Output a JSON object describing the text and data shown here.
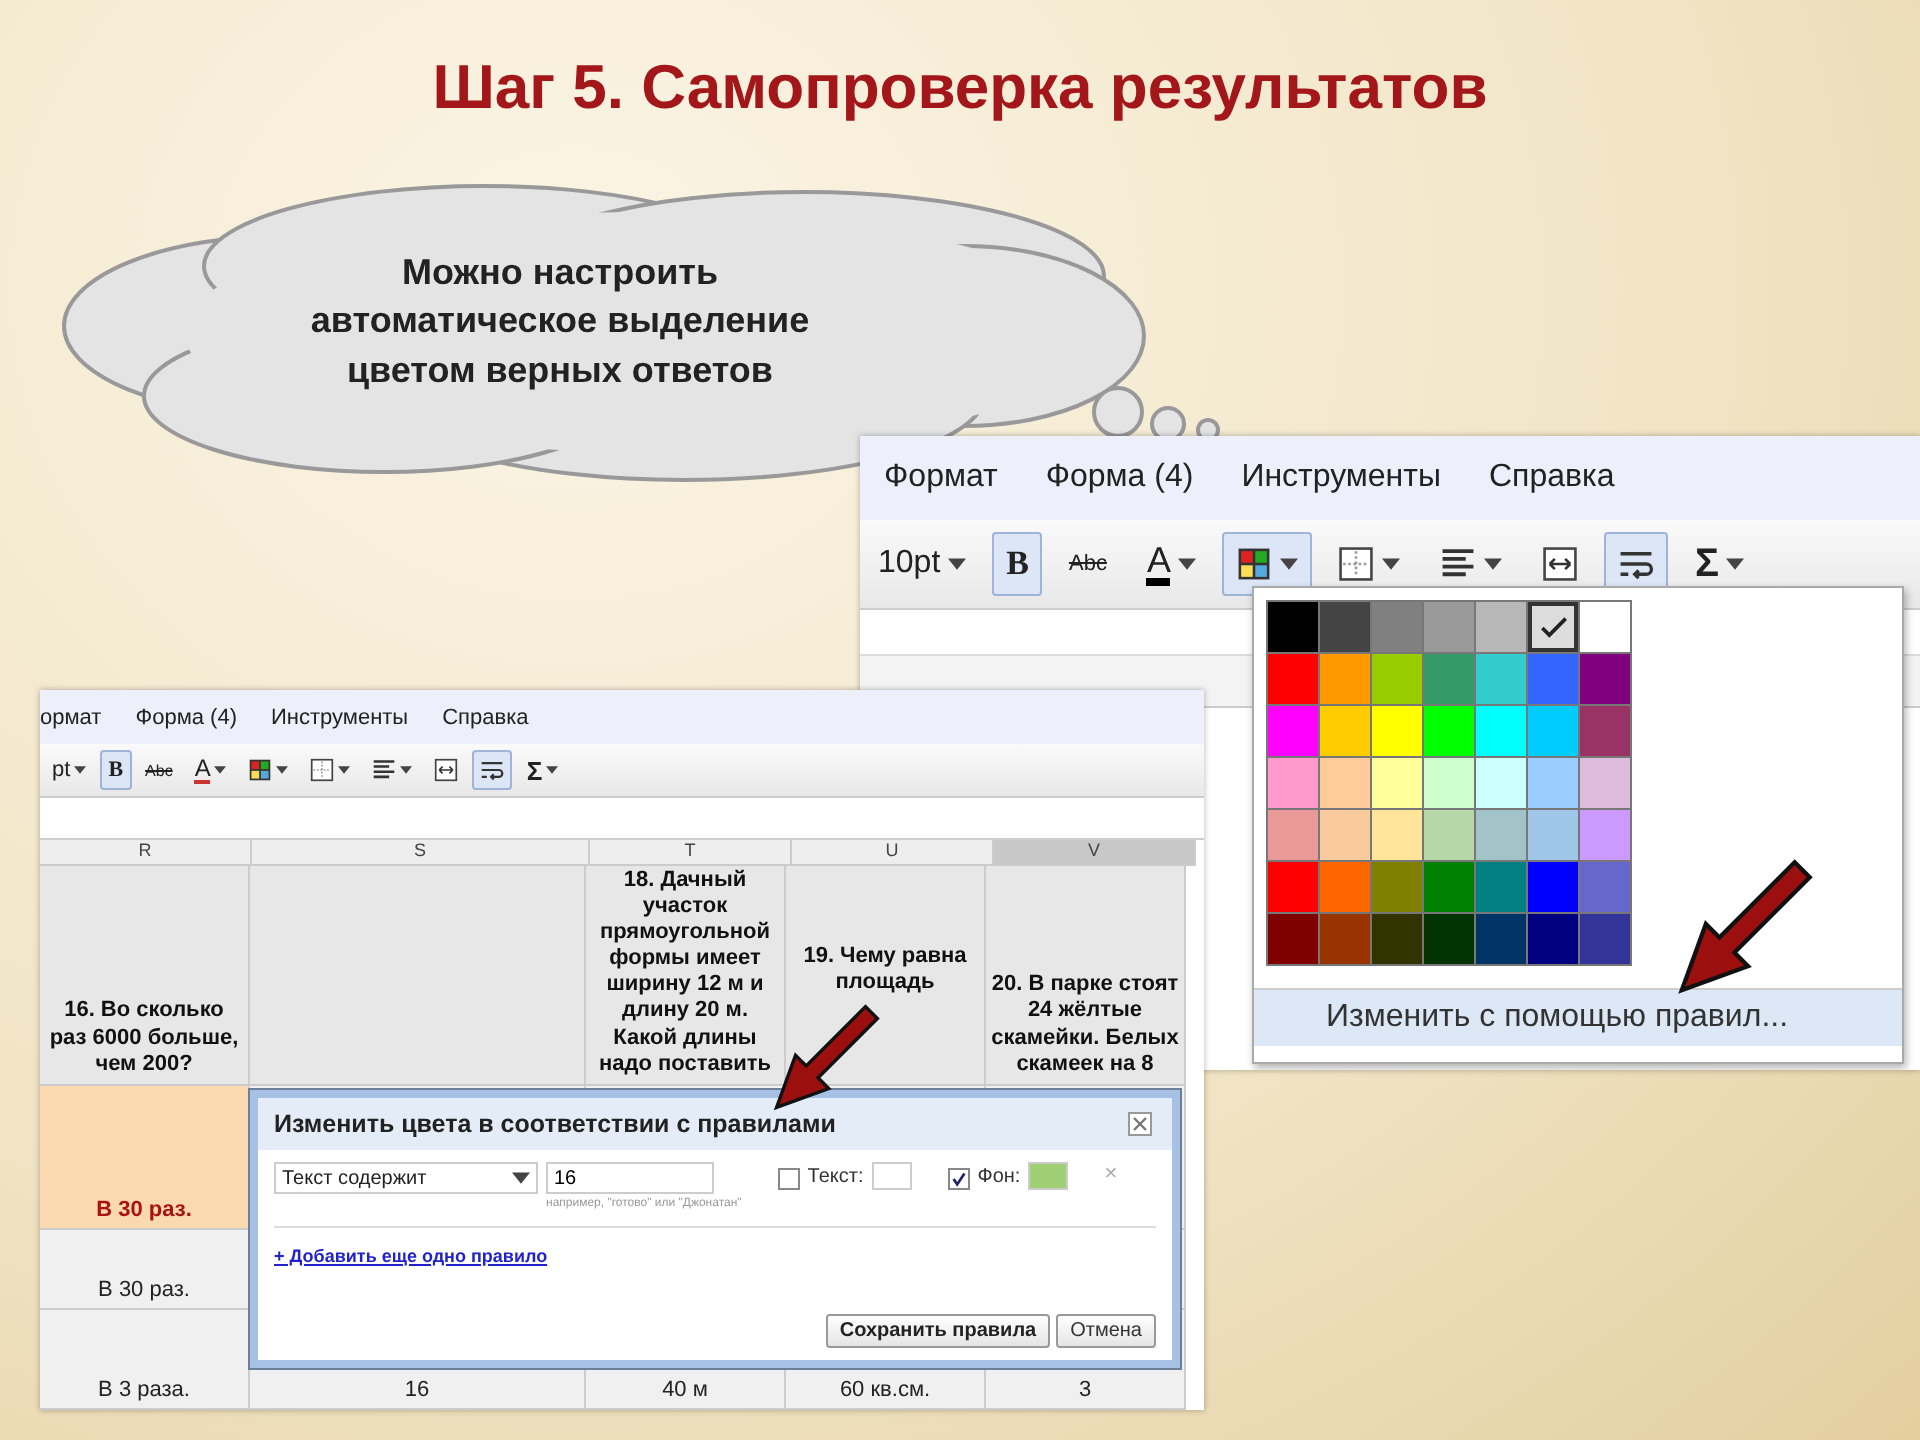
{
  "title": "Шаг 5. Самопроверка результатов",
  "callout": {
    "text": "Можно настроить автоматическое выделение цветом верных ответов"
  },
  "editor_large": {
    "menu": [
      "Формат",
      "Форма (4)",
      "Инструменты",
      "Справка"
    ],
    "toolbar": [
      {
        "kind": "font_size",
        "label": "10pt",
        "dropdown": true,
        "selected": false
      },
      {
        "kind": "bold",
        "label": "B",
        "dropdown": false,
        "selected": true
      },
      {
        "kind": "strike",
        "label": "Abc",
        "dropdown": false,
        "selected": false
      },
      {
        "kind": "text_color",
        "label": "A",
        "dropdown": true,
        "selected": false
      },
      {
        "kind": "fill_color",
        "dropdown": true,
        "selected": true
      },
      {
        "kind": "borders",
        "dropdown": true,
        "selected": false
      },
      {
        "kind": "align",
        "dropdown": true,
        "selected": false
      },
      {
        "kind": "merge",
        "dropdown": false,
        "selected": false
      },
      {
        "kind": "wrap",
        "dropdown": false,
        "selected": true
      },
      {
        "kind": "sum",
        "label": "Σ",
        "dropdown": true,
        "selected": false
      }
    ],
    "palette": {
      "swatch_rows": [
        [
          {
            "color": "#000000",
            "selected": false
          },
          {
            "color": "#444444",
            "selected": false
          },
          {
            "color": "#808080",
            "selected": false
          },
          {
            "color": "#999999",
            "selected": false
          },
          {
            "color": "#b7b7b7",
            "selected": false
          },
          {
            "color": "#dddddd",
            "selected": true
          },
          {
            "color": "#ffffff",
            "selected": false
          }
        ],
        [
          {
            "color": "#ff0000",
            "selected": false
          },
          {
            "color": "#ff9900",
            "selected": false
          },
          {
            "color": "#99cc00",
            "selected": false
          },
          {
            "color": "#339966",
            "selected": false
          },
          {
            "color": "#33cccc",
            "selected": false
          },
          {
            "color": "#3366ff",
            "selected": false
          },
          {
            "color": "#800080",
            "selected": false
          }
        ],
        [
          {
            "color": "#ff00ff",
            "selected": false
          },
          {
            "color": "#ffcc00",
            "selected": false
          },
          {
            "color": "#ffff00",
            "selected": false
          },
          {
            "color": "#00ff00",
            "selected": false
          },
          {
            "color": "#00ffff",
            "selected": false
          },
          {
            "color": "#00ccff",
            "selected": false
          },
          {
            "color": "#993366",
            "selected": false
          }
        ],
        [
          {
            "color": "#ff99cc",
            "selected": false
          },
          {
            "color": "#ffcc99",
            "selected": false
          },
          {
            "color": "#ffff99",
            "selected": false
          },
          {
            "color": "#ccffcc",
            "selected": false
          },
          {
            "color": "#ccffff",
            "selected": false
          },
          {
            "color": "#99ccff",
            "selected": false
          },
          {
            "color": "#ddbbdd",
            "selected": false
          }
        ],
        [
          {
            "color": "#ea9999",
            "selected": false
          },
          {
            "color": "#f9cb9c",
            "selected": false
          },
          {
            "color": "#ffe599",
            "selected": false
          },
          {
            "color": "#b6d7a8",
            "selected": false
          },
          {
            "color": "#a2c4c9",
            "selected": false
          },
          {
            "color": "#9fc5e8",
            "selected": false
          },
          {
            "color": "#cc99ff",
            "selected": false
          }
        ],
        [
          {
            "color": "#ff0000",
            "selected": false
          },
          {
            "color": "#ff6600",
            "selected": false
          },
          {
            "color": "#808000",
            "selected": false
          },
          {
            "color": "#008000",
            "selected": false
          },
          {
            "color": "#008080",
            "selected": false
          },
          {
            "color": "#0000ff",
            "selected": false
          },
          {
            "color": "#6666cc",
            "selected": false
          }
        ],
        [
          {
            "color": "#800000",
            "selected": false
          },
          {
            "color": "#993300",
            "selected": false
          },
          {
            "color": "#333300",
            "selected": false
          },
          {
            "color": "#003300",
            "selected": false
          },
          {
            "color": "#003366",
            "selected": false
          },
          {
            "color": "#000080",
            "selected": false
          },
          {
            "color": "#333399",
            "selected": false
          }
        ]
      ],
      "rule_item": "Изменить с помощью правил..."
    }
  },
  "editor_small": {
    "menu": [
      "ормат",
      "Форма (4)",
      "Инструменты",
      "Справка"
    ],
    "toolbar": [
      {
        "kind": "font_size",
        "label": "pt",
        "dropdown": true,
        "selected": false
      },
      {
        "kind": "bold",
        "label": "B",
        "dropdown": false,
        "selected": true
      },
      {
        "kind": "strike",
        "label": "Abc",
        "dropdown": false,
        "selected": false
      },
      {
        "kind": "text_color",
        "label": "A",
        "dropdown": true,
        "selected": false
      },
      {
        "kind": "fill_color",
        "dropdown": true,
        "selected": false
      },
      {
        "kind": "borders",
        "dropdown": true,
        "selected": false
      },
      {
        "kind": "align",
        "dropdown": true,
        "selected": false
      },
      {
        "kind": "merge",
        "dropdown": false,
        "selected": false
      },
      {
        "kind": "wrap",
        "dropdown": false,
        "selected": true
      },
      {
        "kind": "sum",
        "label": "Σ",
        "dropdown": true,
        "selected": false
      }
    ],
    "columns": [
      {
        "label": "R",
        "selected": false,
        "header": "16. Во сколько раз 6000 больше, чем 200?"
      },
      {
        "label": "S",
        "selected": false
      },
      {
        "label": "T",
        "selected": false,
        "header": "18. Дачный участок прямоугольной формы имеет ширину 12 м и длину 20 м. Какой длины надо поставить"
      },
      {
        "label": "U",
        "selected": false,
        "header": "19. Чему равна площадь"
      },
      {
        "label": "V",
        "selected": true,
        "header": "20. В парке стоят 24 жёлтые скамейки. Белых скамеек на 8"
      }
    ],
    "rows": [
      {
        "cells": [
          {
            "text": "В 30 раз.",
            "highlighted": true
          }
        ]
      },
      {
        "cells": [
          {
            "text": "В 30 раз.",
            "highlighted": false
          }
        ]
      },
      {
        "cells": [
          {
            "text": "В 3 раза.",
            "highlighted": false
          },
          {
            "text": "16",
            "highlighted": false
          },
          {
            "text": "40 м",
            "highlighted": false
          },
          {
            "text": "60 кв.см.",
            "highlighted": false
          },
          {
            "text": "3",
            "highlighted": false
          }
        ]
      }
    ]
  },
  "dialog": {
    "title": "Изменить цвета в соответствии с правилами",
    "condition": "Текст содержит",
    "value": "16",
    "hint": "например, \"готово\" или \"Джонатан\"",
    "text_option": {
      "label": "Текст:",
      "checked": false,
      "color": "#ffffff"
    },
    "background_option": {
      "label": "Фон:",
      "checked": true,
      "color": "#9fcf73"
    },
    "remove": "×",
    "add_link": "+ Добавить еще одно правило",
    "buttons": [
      {
        "kind": "primary",
        "label": "Сохранить правила"
      },
      {
        "kind": "secondary",
        "label": "Отмена"
      }
    ]
  }
}
